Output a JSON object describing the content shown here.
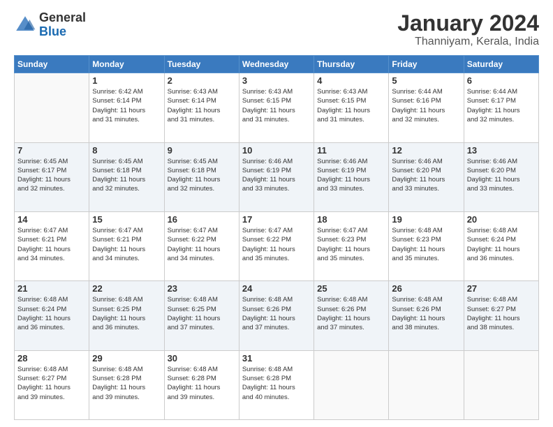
{
  "logo": {
    "line1": "General",
    "line2": "Blue"
  },
  "title": "January 2024",
  "subtitle": "Thanniyam, Kerala, India",
  "weekdays": [
    "Sunday",
    "Monday",
    "Tuesday",
    "Wednesday",
    "Thursday",
    "Friday",
    "Saturday"
  ],
  "weeks": [
    [
      {
        "day": "",
        "info": ""
      },
      {
        "day": "1",
        "info": "Sunrise: 6:42 AM\nSunset: 6:14 PM\nDaylight: 11 hours\nand 31 minutes."
      },
      {
        "day": "2",
        "info": "Sunrise: 6:43 AM\nSunset: 6:14 PM\nDaylight: 11 hours\nand 31 minutes."
      },
      {
        "day": "3",
        "info": "Sunrise: 6:43 AM\nSunset: 6:15 PM\nDaylight: 11 hours\nand 31 minutes."
      },
      {
        "day": "4",
        "info": "Sunrise: 6:43 AM\nSunset: 6:15 PM\nDaylight: 11 hours\nand 31 minutes."
      },
      {
        "day": "5",
        "info": "Sunrise: 6:44 AM\nSunset: 6:16 PM\nDaylight: 11 hours\nand 32 minutes."
      },
      {
        "day": "6",
        "info": "Sunrise: 6:44 AM\nSunset: 6:17 PM\nDaylight: 11 hours\nand 32 minutes."
      }
    ],
    [
      {
        "day": "7",
        "info": "Sunrise: 6:45 AM\nSunset: 6:17 PM\nDaylight: 11 hours\nand 32 minutes."
      },
      {
        "day": "8",
        "info": "Sunrise: 6:45 AM\nSunset: 6:18 PM\nDaylight: 11 hours\nand 32 minutes."
      },
      {
        "day": "9",
        "info": "Sunrise: 6:45 AM\nSunset: 6:18 PM\nDaylight: 11 hours\nand 32 minutes."
      },
      {
        "day": "10",
        "info": "Sunrise: 6:46 AM\nSunset: 6:19 PM\nDaylight: 11 hours\nand 33 minutes."
      },
      {
        "day": "11",
        "info": "Sunrise: 6:46 AM\nSunset: 6:19 PM\nDaylight: 11 hours\nand 33 minutes."
      },
      {
        "day": "12",
        "info": "Sunrise: 6:46 AM\nSunset: 6:20 PM\nDaylight: 11 hours\nand 33 minutes."
      },
      {
        "day": "13",
        "info": "Sunrise: 6:46 AM\nSunset: 6:20 PM\nDaylight: 11 hours\nand 33 minutes."
      }
    ],
    [
      {
        "day": "14",
        "info": "Sunrise: 6:47 AM\nSunset: 6:21 PM\nDaylight: 11 hours\nand 34 minutes."
      },
      {
        "day": "15",
        "info": "Sunrise: 6:47 AM\nSunset: 6:21 PM\nDaylight: 11 hours\nand 34 minutes."
      },
      {
        "day": "16",
        "info": "Sunrise: 6:47 AM\nSunset: 6:22 PM\nDaylight: 11 hours\nand 34 minutes."
      },
      {
        "day": "17",
        "info": "Sunrise: 6:47 AM\nSunset: 6:22 PM\nDaylight: 11 hours\nand 35 minutes."
      },
      {
        "day": "18",
        "info": "Sunrise: 6:47 AM\nSunset: 6:23 PM\nDaylight: 11 hours\nand 35 minutes."
      },
      {
        "day": "19",
        "info": "Sunrise: 6:48 AM\nSunset: 6:23 PM\nDaylight: 11 hours\nand 35 minutes."
      },
      {
        "day": "20",
        "info": "Sunrise: 6:48 AM\nSunset: 6:24 PM\nDaylight: 11 hours\nand 36 minutes."
      }
    ],
    [
      {
        "day": "21",
        "info": "Sunrise: 6:48 AM\nSunset: 6:24 PM\nDaylight: 11 hours\nand 36 minutes."
      },
      {
        "day": "22",
        "info": "Sunrise: 6:48 AM\nSunset: 6:25 PM\nDaylight: 11 hours\nand 36 minutes."
      },
      {
        "day": "23",
        "info": "Sunrise: 6:48 AM\nSunset: 6:25 PM\nDaylight: 11 hours\nand 37 minutes."
      },
      {
        "day": "24",
        "info": "Sunrise: 6:48 AM\nSunset: 6:26 PM\nDaylight: 11 hours\nand 37 minutes."
      },
      {
        "day": "25",
        "info": "Sunrise: 6:48 AM\nSunset: 6:26 PM\nDaylight: 11 hours\nand 37 minutes."
      },
      {
        "day": "26",
        "info": "Sunrise: 6:48 AM\nSunset: 6:26 PM\nDaylight: 11 hours\nand 38 minutes."
      },
      {
        "day": "27",
        "info": "Sunrise: 6:48 AM\nSunset: 6:27 PM\nDaylight: 11 hours\nand 38 minutes."
      }
    ],
    [
      {
        "day": "28",
        "info": "Sunrise: 6:48 AM\nSunset: 6:27 PM\nDaylight: 11 hours\nand 39 minutes."
      },
      {
        "day": "29",
        "info": "Sunrise: 6:48 AM\nSunset: 6:28 PM\nDaylight: 11 hours\nand 39 minutes."
      },
      {
        "day": "30",
        "info": "Sunrise: 6:48 AM\nSunset: 6:28 PM\nDaylight: 11 hours\nand 39 minutes."
      },
      {
        "day": "31",
        "info": "Sunrise: 6:48 AM\nSunset: 6:28 PM\nDaylight: 11 hours\nand 40 minutes."
      },
      {
        "day": "",
        "info": ""
      },
      {
        "day": "",
        "info": ""
      },
      {
        "day": "",
        "info": ""
      }
    ]
  ]
}
